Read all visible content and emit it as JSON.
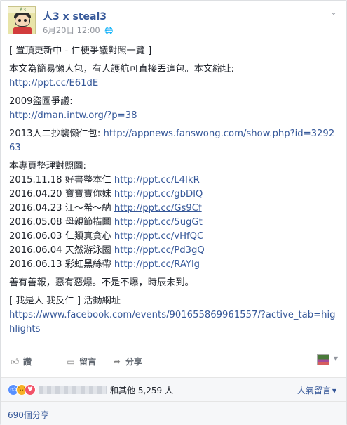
{
  "post": {
    "page_name": "人3 x steal3",
    "timestamp": "6月20日 12:00",
    "avatar_text": "人3 x steal3",
    "menu_icon": "chevron-down-icon",
    "privacy_icon": "globe-icon"
  },
  "content": {
    "title": "[ 置頂更新中 - 仁梗爭議對照一覽 ]",
    "intro": "本文為簡易懶人包，有人護航可直接丟這包。本文縮址:",
    "intro_link": "http://ppt.cc/E61dE",
    "dispute_label": "2009盜圖爭議:",
    "dispute_link": "http://dman.intw.org/?p=38",
    "lazy_label": "2013人二抄襲懶仁包:",
    "lazy_link": "http://appnews.fanswong.com/show.php?id=329263",
    "compare_label": "本專頁整理對照圖:",
    "entries": [
      {
        "date": "2015.11.18",
        "title": "好書整本仁",
        "link": "http://ppt.cc/L4IkR"
      },
      {
        "date": "2016.04.20",
        "title": "寶寶寶你妹",
        "link": "http://ppt.cc/gbDlQ"
      },
      {
        "date": "2016.04.23",
        "title": "江～希～納",
        "link": "http://ppt.cc/Gs9Cf"
      },
      {
        "date": "2016.05.08",
        "title": "母親節描圖",
        "link": "http://ppt.cc/5ugGt"
      },
      {
        "date": "2016.06.03",
        "title": "仁類真貪心",
        "link": "http://ppt.cc/vHfQC"
      },
      {
        "date": "2016.06.04",
        "title": "天然游泳圈",
        "link": "http://ppt.cc/Pd3gQ"
      },
      {
        "date": "2016.06.13",
        "title": "彩虹黑絲帶",
        "link": "http://ppt.cc/RAYlg"
      }
    ],
    "motto": "善有善報，惡有惡爆。不是不爆，時辰未到。",
    "event_label": "[ 我是人 我反仁 ] 活動網址",
    "event_link": "https://www.facebook.com/events/901655869961557/?active_tab=highlights"
  },
  "actions": {
    "like": "讚",
    "comment": "留言",
    "share": "分享",
    "like_icon": "thumbs-up-icon",
    "comment_icon": "speech-bubble-icon",
    "share_icon": "share-arrow-icon"
  },
  "reactions": {
    "summary": "和其他 5,259 人",
    "sort_label": "人氣留言",
    "icons": [
      "like-reaction-icon",
      "haha-reaction-icon",
      "love-reaction-icon"
    ]
  },
  "shares": {
    "count_label": "690個分享"
  },
  "colors": {
    "link": "#365899",
    "text": "#1d2129",
    "meta": "#90949c"
  }
}
